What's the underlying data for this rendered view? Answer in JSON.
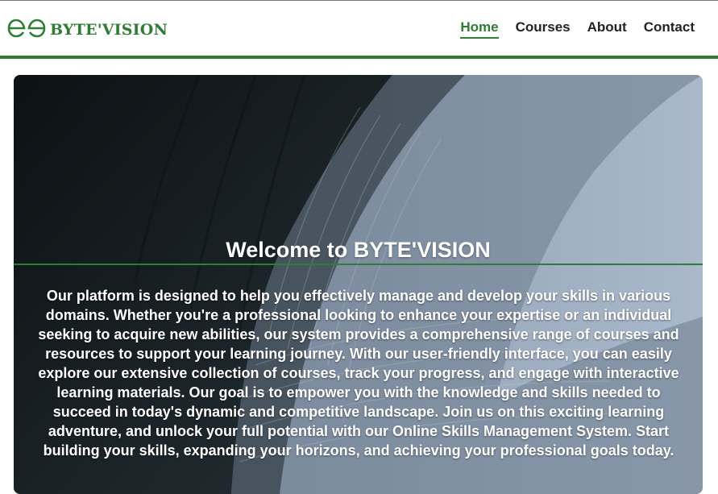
{
  "brand": {
    "name": "BYTE'VISION",
    "logo_icon": "gg-logo-icon",
    "color": "#2e7d32"
  },
  "nav": {
    "items": [
      {
        "label": "Home",
        "active": true
      },
      {
        "label": "Courses",
        "active": false
      },
      {
        "label": "About",
        "active": false
      },
      {
        "label": "Contact",
        "active": false
      }
    ]
  },
  "hero": {
    "title": "Welcome to BYTE'VISION",
    "body": "Our platform is designed to help you effectively manage and develop your skills in various domains. Whether you're a professional looking to enhance your expertise or an individual seeking to acquire new abilities, our system provides a comprehensive range of courses and resources to support your learning journey. With our user-friendly interface, you can easily explore our extensive collection of courses, track your progress, and engage with interactive learning materials. Our goal is to empower you with the knowledge and skills needed to succeed in today's dynamic and competitive landscape. Join us on this exciting learning adventure, and unlock your full potential with our Online Skills Management System. Start building your skills, expanding your horizons, and achieving your professional goals today.",
    "background_image": "architecture-facade-image"
  },
  "colors": {
    "accent": "#2e7d32",
    "nav_text": "#222222",
    "hero_text": "#ffffff"
  }
}
